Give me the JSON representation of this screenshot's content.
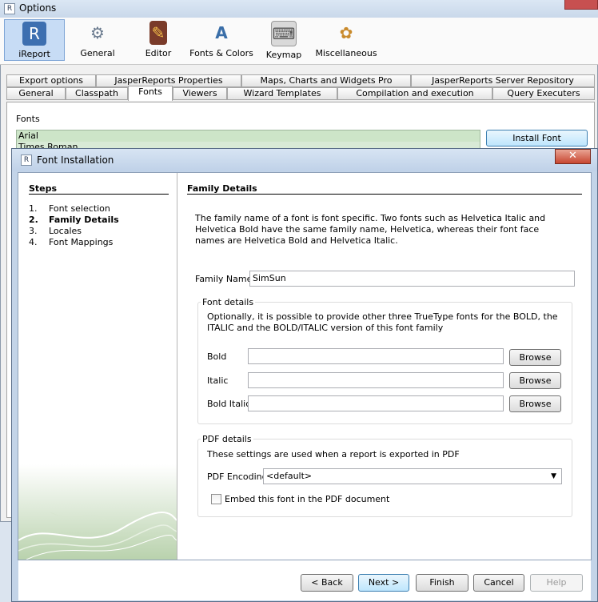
{
  "options": {
    "title": "Options",
    "toolbar": [
      {
        "label": "iReport",
        "icon": "ireport-icon",
        "selected": true
      },
      {
        "label": "General",
        "icon": "gears-icon"
      },
      {
        "label": "Editor",
        "icon": "book-pencil-icon"
      },
      {
        "label": "Fonts & Colors",
        "icon": "fonts-colors-icon"
      },
      {
        "label": "Keymap",
        "icon": "keyboard-icon"
      },
      {
        "label": "Miscellaneous",
        "icon": "misc-icon"
      }
    ],
    "tabs_row1": [
      "Export options",
      "JasperReports Properties",
      "Maps, Charts and Widgets Pro",
      "JasperReports Server Repository"
    ],
    "tabs_row2": [
      "General",
      "Classpath",
      "Fonts",
      "Viewers",
      "Wizard Templates",
      "Compilation and execution",
      "Query Executers"
    ],
    "active_tab": "Fonts",
    "fonts_label": "Fonts",
    "fonts_list": [
      "Arial",
      "Times Roman"
    ],
    "install_font_label": "Install Font"
  },
  "dialog": {
    "title": "Font Installation",
    "close_glyph": "✕",
    "steps_title": "Steps",
    "steps": [
      {
        "num": "1.",
        "label": "Font selection"
      },
      {
        "num": "2.",
        "label": "Family Details",
        "current": true
      },
      {
        "num": "3.",
        "label": "Locales"
      },
      {
        "num": "4.",
        "label": "Font Mappings"
      }
    ],
    "details_title": "Family Details",
    "description": "The family name of a font is font specific. Two fonts such as Helvetica Italic and Helvetica Bold have the same family name, Helvetica, whereas their font face names are Helvetica Bold and Helvetica Italic.",
    "family_name_label": "Family Name",
    "family_name_value": "SimSun",
    "font_details": {
      "legend": "Font details",
      "desc": "Optionally, it is possible to provide other three TrueType fonts for the BOLD, the ITALIC and the BOLD/ITALIC version of this font family",
      "bold_label": "Bold",
      "italic_label": "Italic",
      "bold_italic_label": "Bold Italic",
      "bold_value": "",
      "italic_value": "",
      "bold_italic_value": "",
      "browse_label": "Browse"
    },
    "pdf_details": {
      "legend": "PDF details",
      "desc": "These settings are used when a report is exported in PDF",
      "encoding_label": "PDF Encoding",
      "encoding_value": "<default>",
      "embed_label": "Embed this font in the PDF document",
      "embed_checked": false
    },
    "buttons": {
      "back": "< Back",
      "next": "Next >",
      "finish": "Finish",
      "cancel": "Cancel",
      "help": "Help"
    }
  }
}
